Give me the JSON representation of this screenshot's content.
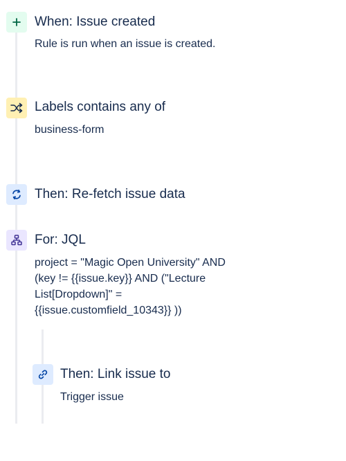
{
  "steps": [
    {
      "title": "When: Issue created",
      "description": "Rule is run when an issue is created.",
      "icon": "plus-icon"
    },
    {
      "title": "Labels contains any of",
      "description": "business-form",
      "icon": "shuffle-icon"
    },
    {
      "title": "Then: Re-fetch issue data",
      "icon": "refresh-icon"
    },
    {
      "title": "For: JQL",
      "description_lines": [
        "project = \"Magic Open University\" AND",
        "(key != {{issue.key}} AND (\"Lecture",
        "List[Dropdown]\" =",
        "{{issue.customfield_10343}} ))"
      ],
      "icon": "branch-icon"
    },
    {
      "title": "Then: Link issue to",
      "description": "Trigger issue",
      "icon": "link-icon"
    }
  ],
  "colors": {
    "trigger_bg": "#e3fcef",
    "condition_bg": "#fff0b3",
    "action_bg": "#deebff",
    "branch_bg": "#eae6ff",
    "rail": "#ebecf0",
    "text": "#172b4d"
  }
}
